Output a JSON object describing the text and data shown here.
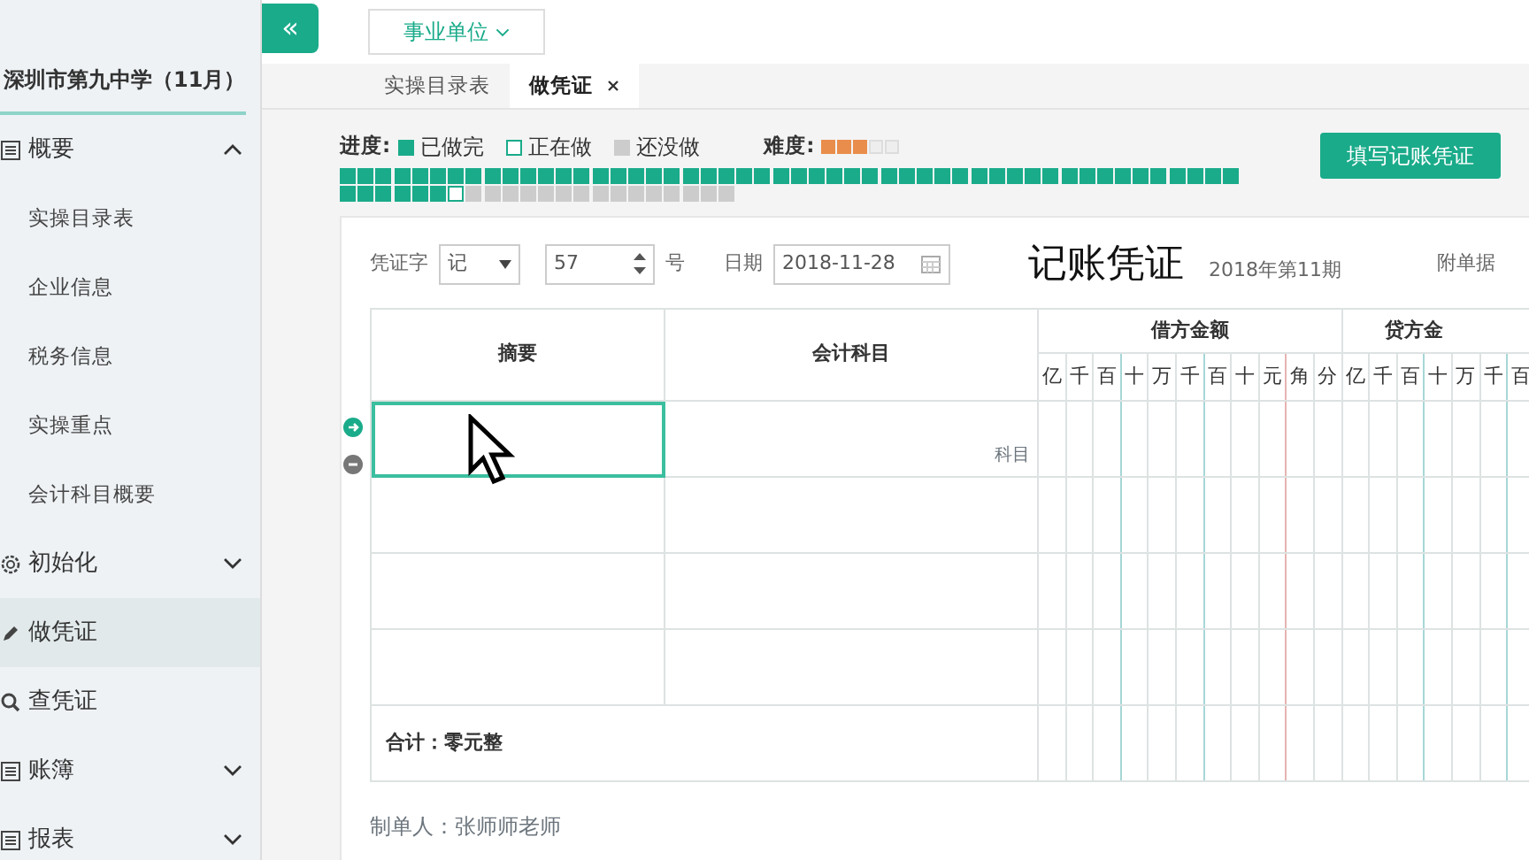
{
  "sidebar": {
    "title": "深圳市第九中学（11月）",
    "items": [
      {
        "label": "概要",
        "expanded": true,
        "selected": false,
        "children": [
          {
            "label": "实操目录表",
            "selected": false
          },
          {
            "label": "企业信息",
            "selected": false
          },
          {
            "label": "税务信息",
            "selected": false
          },
          {
            "label": "实操重点",
            "selected": false
          },
          {
            "label": "会计科目概要",
            "selected": false
          }
        ]
      },
      {
        "label": "初始化",
        "expanded": false,
        "selected": false
      },
      {
        "label": "做凭证",
        "selected": true
      },
      {
        "label": "查凭证",
        "selected": false
      },
      {
        "label": "账簿",
        "expanded": false,
        "selected": false
      },
      {
        "label": "报表",
        "expanded": false,
        "selected": false
      }
    ]
  },
  "collapse_button": "«",
  "unit_dropdown": "事业单位",
  "tabs": [
    {
      "label": "实操目录表",
      "selected": false
    },
    {
      "label": "做凭证",
      "selected": true
    }
  ],
  "progress": {
    "label": "进度:",
    "legend": [
      {
        "kind": "done",
        "text": "已做完"
      },
      {
        "kind": "current",
        "text": "正在做"
      },
      {
        "kind": "todo",
        "text": "还没做"
      }
    ],
    "difficulty_label": "难度:",
    "stars": 3,
    "cells": [
      {
        "kind": "done"
      },
      {
        "kind": "done"
      },
      {
        "kind": "done"
      },
      {
        "kind": "done"
      },
      {
        "kind": "done"
      },
      {
        "kind": "done"
      },
      {
        "kind": "done"
      },
      {
        "kind": "done"
      },
      {
        "kind": "done"
      },
      {
        "kind": "done"
      },
      {
        "kind": "done"
      },
      {
        "kind": "done"
      },
      {
        "kind": "done"
      },
      {
        "kind": "done"
      },
      {
        "kind": "done"
      },
      {
        "kind": "done"
      },
      {
        "kind": "done"
      },
      {
        "kind": "done"
      },
      {
        "kind": "done"
      },
      {
        "kind": "done"
      },
      {
        "kind": "done"
      },
      {
        "kind": "done"
      },
      {
        "kind": "done"
      },
      {
        "kind": "done"
      },
      {
        "kind": "done"
      },
      {
        "kind": "done"
      },
      {
        "kind": "done"
      },
      {
        "kind": "done"
      },
      {
        "kind": "done"
      },
      {
        "kind": "done"
      },
      {
        "kind": "done"
      },
      {
        "kind": "done"
      },
      {
        "kind": "done"
      },
      {
        "kind": "done"
      },
      {
        "kind": "done"
      },
      {
        "kind": "done"
      },
      {
        "kind": "done"
      },
      {
        "kind": "done"
      },
      {
        "kind": "done"
      },
      {
        "kind": "done"
      },
      {
        "kind": "done"
      },
      {
        "kind": "done"
      },
      {
        "kind": "done"
      },
      {
        "kind": "done"
      },
      {
        "kind": "done"
      },
      {
        "kind": "done"
      },
      {
        "kind": "done"
      },
      {
        "kind": "done"
      },
      {
        "kind": "done"
      },
      {
        "kind": "done"
      },
      {
        "kind": "done"
      },
      {
        "kind": "done"
      },
      {
        "kind": "done"
      },
      {
        "kind": "done"
      },
      {
        "kind": "done"
      },
      {
        "kind": "done"
      },
      {
        "kind": "current"
      },
      {
        "kind": "todo"
      },
      {
        "kind": "todo"
      },
      {
        "kind": "todo"
      },
      {
        "kind": "todo"
      },
      {
        "kind": "todo"
      },
      {
        "kind": "todo"
      },
      {
        "kind": "todo"
      },
      {
        "kind": "todo"
      },
      {
        "kind": "todo"
      },
      {
        "kind": "todo"
      },
      {
        "kind": "todo"
      },
      {
        "kind": "todo"
      },
      {
        "kind": "todo"
      },
      {
        "kind": "todo"
      },
      {
        "kind": "todo"
      }
    ]
  },
  "fill_button": "填写记账凭证",
  "voucher": {
    "word_label": "凭证字",
    "word": "记",
    "number": "57",
    "number_suffix": "号",
    "date_label": "日期",
    "date": "2018-11-28",
    "title": "记账凭证",
    "period": "2018年第11期",
    "attachments_label": "附单据",
    "columns": [
      "摘要",
      "会计科目"
    ],
    "debit_header": "借方金额",
    "credit_header": "贷方金",
    "debit_digits": [
      "亿",
      "千",
      "百",
      "十",
      "万",
      "千",
      "百",
      "十",
      "元",
      "角",
      "分"
    ],
    "credit_digits": [
      "亿",
      "千",
      "百",
      "十",
      "万",
      "千",
      "百"
    ],
    "rows": [
      {
        "selected": true,
        "placeholder": "科目"
      },
      {
        "selected": false
      },
      {
        "selected": false
      },
      {
        "selected": false
      }
    ],
    "total": "合计：零元整",
    "maker": "制单人：张师师老师"
  }
}
